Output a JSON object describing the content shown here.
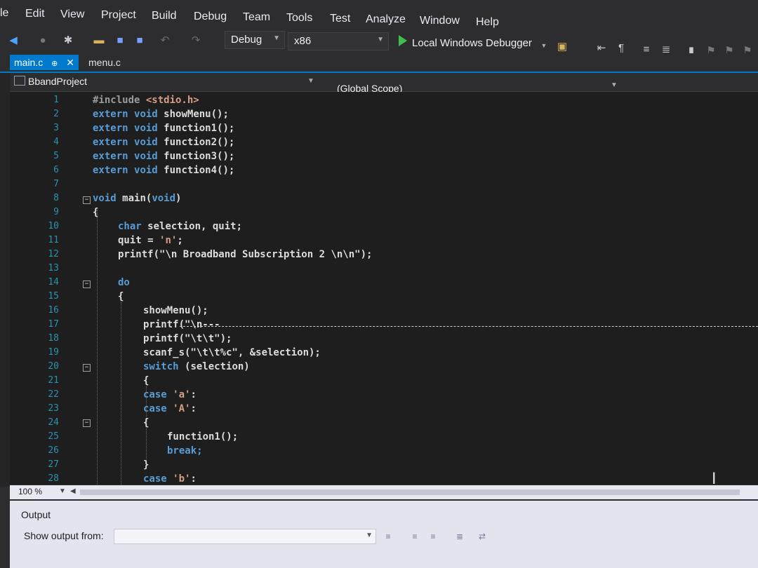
{
  "menu": [
    "le",
    "Edit",
    "View",
    "Project",
    "Build",
    "Debug",
    "Team",
    "Tools",
    "Test",
    "Analyze",
    "Window",
    "Help"
  ],
  "toolbar": {
    "config": "Debug",
    "platform": "x86",
    "debugger": "Local Windows Debugger",
    "icons": [
      "back-icon",
      "forward-icon",
      "new-project-icon",
      "open-icon",
      "save-icon",
      "save-all-icon",
      "undo-icon",
      "redo-icon",
      "play-icon",
      "attach-icon",
      "navigate-icon",
      "indent-icon",
      "comment-icon",
      "bookmark-icon"
    ]
  },
  "tabs": [
    {
      "label": "main.c",
      "active": true,
      "pin": "⊕",
      "close": "✕"
    },
    {
      "label": "menu.c",
      "active": false
    }
  ],
  "navbar": {
    "project": "BbandProject",
    "scope": "(Global Scope)"
  },
  "editor": {
    "line_numbers": [
      "1",
      "2",
      "3",
      "4",
      "5",
      "6",
      "7",
      "8",
      "9",
      "10",
      "11",
      "12",
      "13",
      "14",
      "15",
      "16",
      "17",
      "18",
      "19",
      "20",
      "21",
      "22",
      "23",
      "24",
      "25",
      "26",
      "27",
      "28"
    ],
    "lines": [
      [
        "",
        "#include ",
        "<stdio.h>"
      ],
      [
        "extern ",
        "void ",
        "showMenu();"
      ],
      [
        "extern ",
        "void ",
        "function1();"
      ],
      [
        "extern ",
        "void ",
        "function2();"
      ],
      [
        "extern ",
        "void ",
        "function3();"
      ],
      [
        "extern ",
        "void ",
        "function4();"
      ],
      [
        "",
        "",
        ""
      ],
      [
        "void ",
        "main(",
        "void",
        ")"
      ],
      [
        "{"
      ],
      [
        "char ",
        "selection, quit;"
      ],
      [
        "quit = ",
        "'n'",
        ";"
      ],
      [
        "printf(",
        "\"\\n Broadband Subscription 2 \\n\\n\"",
        ");"
      ],
      [
        ""
      ],
      [
        "do"
      ],
      [
        "{"
      ],
      [
        "showMenu();"
      ],
      [
        "printf(\"\\n---"
      ],
      [
        "printf(\"\\t\\t\");"
      ],
      [
        "scanf_s(\"\\t\\t%c\", &selection);"
      ],
      [
        "switch ",
        "(selection)"
      ],
      [
        "{"
      ],
      [
        "case ",
        "'a'",
        ":"
      ],
      [
        "case ",
        "'A'",
        ":"
      ],
      [
        "{"
      ],
      [
        "function1();"
      ],
      [
        "break;"
      ],
      [
        "}"
      ],
      [
        "case ",
        "'b'",
        ":"
      ]
    ]
  },
  "statusbar": {
    "zoom": "100 %"
  },
  "output": {
    "title": "Output",
    "show_from_label": "Show output from:"
  }
}
